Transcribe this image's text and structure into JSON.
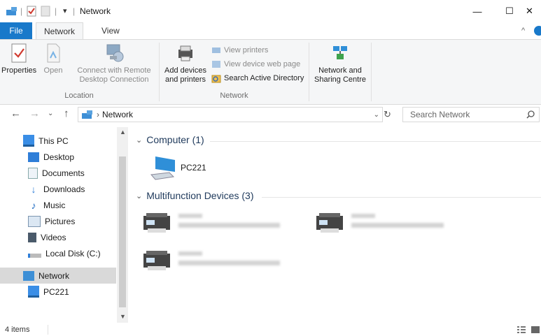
{
  "titlebar": {
    "title": "Network",
    "qa_divider": "|",
    "qa_arrow": "▾",
    "minimize": "—",
    "maximize": "☐",
    "close": "✕"
  },
  "tabs": {
    "file": "File",
    "network": "Network",
    "view": "View",
    "collapse": "^"
  },
  "ribbon": {
    "location": {
      "properties": "Properties",
      "open": "Open",
      "connect_line1": "Connect with Remote",
      "connect_line2": "Desktop Connection",
      "label": "Location"
    },
    "network": {
      "add_line1": "Add devices",
      "add_line2": "and printers",
      "view_printers": "View printers",
      "view_device_web": "View device web page",
      "search_ad": "Search Active Directory",
      "label": "Network"
    },
    "sharing": {
      "line1": "Network and",
      "line2": "Sharing Centre"
    }
  },
  "address": {
    "path": "Network",
    "search_placeholder": "Search Network"
  },
  "nav": {
    "items": [
      {
        "label": "This PC",
        "icon": "this-pc-icon"
      },
      {
        "label": "Desktop",
        "icon": "desktop-icon"
      },
      {
        "label": "Documents",
        "icon": "documents-icon"
      },
      {
        "label": "Downloads",
        "icon": "downloads-icon"
      },
      {
        "label": "Music",
        "icon": "music-icon"
      },
      {
        "label": "Pictures",
        "icon": "pictures-icon"
      },
      {
        "label": "Videos",
        "icon": "videos-icon"
      },
      {
        "label": "Local Disk (C:)",
        "icon": "local-disk-icon"
      },
      {
        "label": "Network",
        "icon": "network-icon"
      },
      {
        "label": "PC221",
        "icon": "computer-icon"
      }
    ]
  },
  "content": {
    "group1": {
      "header": "Computer (1)",
      "items": [
        "PC221"
      ]
    },
    "group2": {
      "header": "Multifunction Devices (3)"
    }
  },
  "status": {
    "count": "4 items"
  },
  "colors": {
    "accent": "#1979ca",
    "selected": "#cce8ff",
    "nav_selected": "#d9d9d9"
  }
}
